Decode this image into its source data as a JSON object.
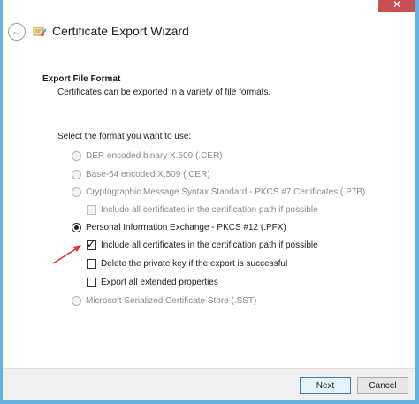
{
  "window": {
    "close_glyph": "✕",
    "title": "Certificate Export Wizard",
    "back_icon": "back-arrow-icon",
    "wizard_icon": "certificate-icon"
  },
  "section": {
    "title": "Export File Format",
    "description": "Certificates can be exported in a variety of file formats."
  },
  "prompt": "Select the format you want to use:",
  "options": [
    {
      "label": "DER encoded binary X.509 (.CER)",
      "selected": false,
      "enabled": false
    },
    {
      "label": "Base-64 encoded X.509 (.CER)",
      "selected": false,
      "enabled": false
    },
    {
      "label": "Cryptographic Message Syntax Standard - PKCS #7 Certificates (.P7B)",
      "selected": false,
      "enabled": false
    },
    {
      "label": "Personal Information Exchange - PKCS #12 (.PFX)",
      "selected": true,
      "enabled": true
    },
    {
      "label": "Microsoft Serialized Certificate Store (.SST)",
      "selected": false,
      "enabled": false
    }
  ],
  "p7b_suboptions": [
    {
      "label": "Include all certificates in the certification path if possible",
      "checked": false,
      "enabled": false
    }
  ],
  "pfx_suboptions": [
    {
      "label": "Include all certificates in the certification path if possible",
      "checked": true,
      "enabled": true
    },
    {
      "label": "Delete the private key if the export is successful",
      "checked": false,
      "enabled": true
    },
    {
      "label": "Export all extended properties",
      "checked": false,
      "enabled": true
    }
  ],
  "buttons": {
    "next": "Next",
    "cancel": "Cancel"
  },
  "colors": {
    "window_border": "#66b0e0",
    "close_button": "#c75050",
    "annotation_arrow": "#e03030",
    "footer_bg": "#f0f0f0"
  }
}
